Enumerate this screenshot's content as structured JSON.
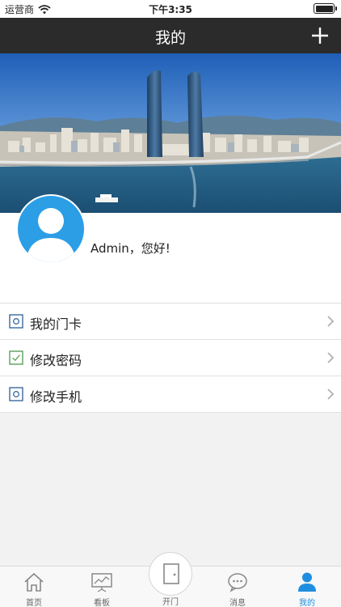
{
  "status_bar": {
    "carrier": "运营商",
    "time": "下午3:35"
  },
  "nav": {
    "title": "我的"
  },
  "profile": {
    "greeting": "Admin，您好!"
  },
  "menu": {
    "items": [
      {
        "label": "我的门卡",
        "icon": "square-circle-icon"
      },
      {
        "label": "修改密码",
        "icon": "square-check-icon"
      },
      {
        "label": "修改手机",
        "icon": "square-circle-icon"
      }
    ]
  },
  "tabbar": {
    "tabs": [
      {
        "label": "首页",
        "icon": "home-icon"
      },
      {
        "label": "看板",
        "icon": "chart-board-icon"
      },
      {
        "label": "开门",
        "icon": "door-icon"
      },
      {
        "label": "消息",
        "icon": "chat-icon"
      },
      {
        "label": "我的",
        "icon": "user-icon"
      }
    ],
    "active_index": 4
  },
  "colors": {
    "accent": "#1e8fe0",
    "nav_bg": "#2b2b2b",
    "avatar_bg": "#2c9ee6"
  }
}
